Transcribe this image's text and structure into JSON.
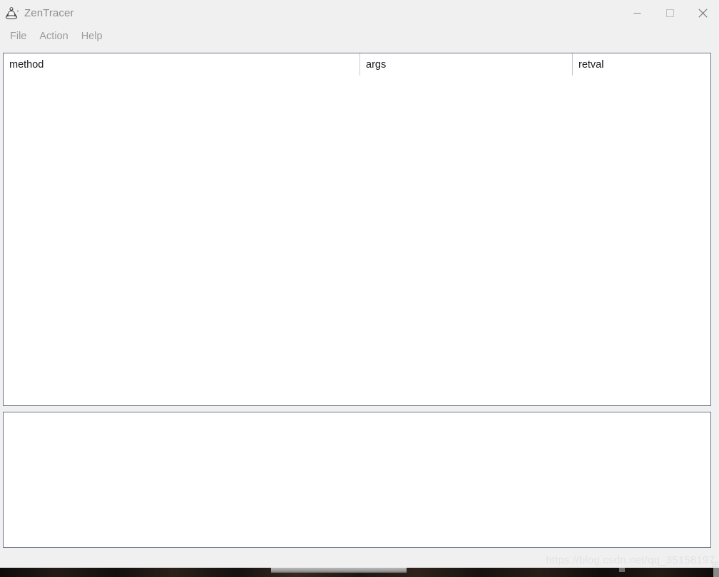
{
  "window": {
    "title": "ZenTracer",
    "icon": "zen-meditation-figure-icon",
    "controls": {
      "minimize": "–",
      "maximize": "□",
      "close": "✕"
    }
  },
  "menubar": {
    "items": [
      {
        "label": "File"
      },
      {
        "label": "Action"
      },
      {
        "label": "Help"
      }
    ]
  },
  "trace_table": {
    "columns": [
      {
        "key": "method",
        "label": "method"
      },
      {
        "key": "args",
        "label": "args"
      },
      {
        "key": "retval",
        "label": "retval"
      }
    ],
    "rows": []
  },
  "detail_panel": {
    "content": ""
  },
  "watermark": {
    "text": "https://blog.csdn.net/qq_35158197"
  },
  "colors": {
    "window_background": "#f0f0f0",
    "panel_background": "#ffffff",
    "panel_border": "#6e7585",
    "title_text": "#8d8d8d",
    "menu_text": "#9a9a9a",
    "header_text": "#1a1a1a",
    "column_divider": "#c8c8c8",
    "watermark_text": "#e2e2e2"
  }
}
